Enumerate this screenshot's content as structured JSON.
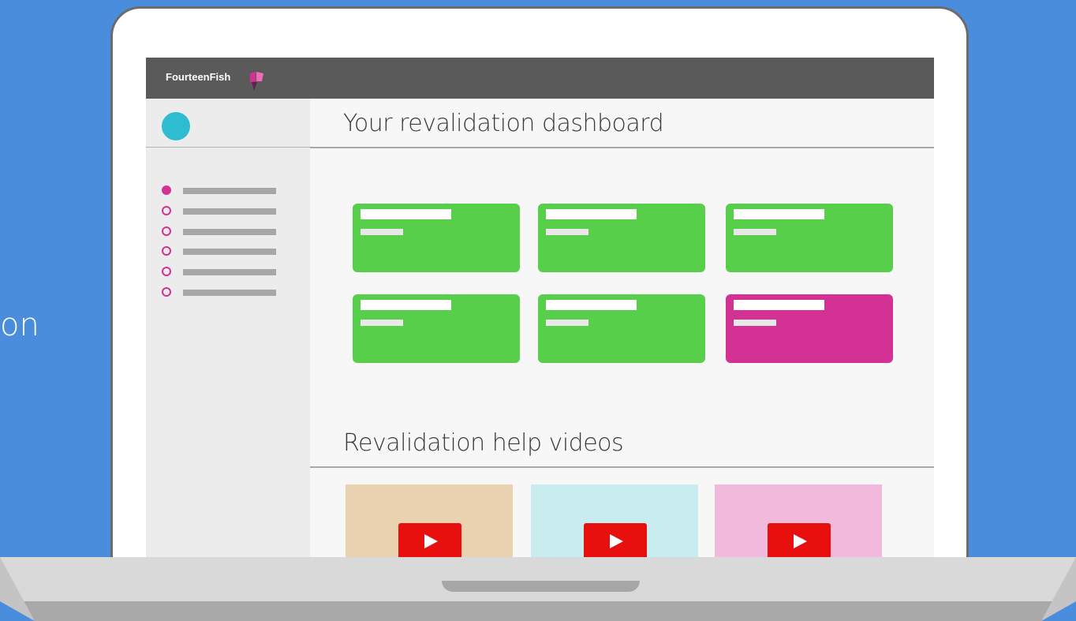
{
  "background_color": "#4a8ddd",
  "edge_text": "on",
  "app": {
    "brand": "FourteenFish",
    "accent_color": "#d33294",
    "avatar_color": "#2fbcd0"
  },
  "sidebar": {
    "items": [
      {
        "state": "active"
      },
      {
        "state": "inactive"
      },
      {
        "state": "inactive"
      },
      {
        "state": "inactive"
      },
      {
        "state": "inactive"
      },
      {
        "state": "inactive"
      }
    ]
  },
  "dashboard": {
    "title": "Your revalidation dashboard",
    "cards": [
      {
        "color": "#57cf4a"
      },
      {
        "color": "#57cf4a"
      },
      {
        "color": "#57cf4a"
      },
      {
        "color": "#57cf4a"
      },
      {
        "color": "#57cf4a"
      },
      {
        "color": "#d33294"
      }
    ]
  },
  "videos": {
    "title": "Revalidation help videos",
    "items": [
      {
        "thumb_color": "#ebd3b2",
        "icon": "play-icon"
      },
      {
        "thumb_color": "#c9ecef",
        "icon": "play-icon"
      },
      {
        "thumb_color": "#f1b9dc",
        "icon": "play-icon"
      }
    ]
  }
}
